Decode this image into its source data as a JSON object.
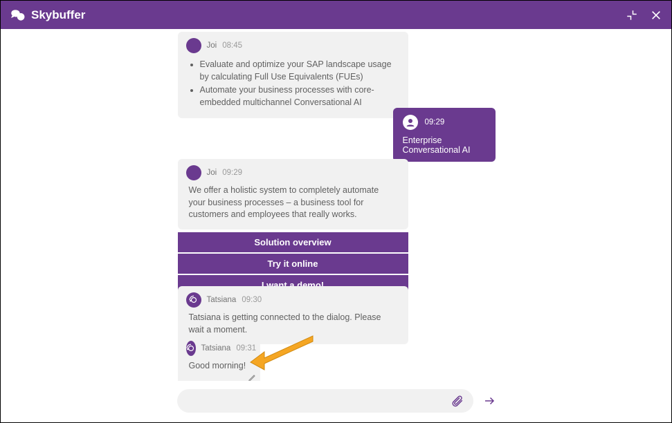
{
  "header": {
    "title": "Skybuffer"
  },
  "messages": {
    "m0": {
      "sender": "Joi",
      "time": "08:45",
      "bullets": [
        "Evaluate and optimize your SAP landscape usage by calculating Full Use Equivalents (FUEs)",
        "Automate your business processes with core-embedded multichannel Conversational AI"
      ]
    },
    "m1": {
      "time": "09:29",
      "text": "Enterprise Conversational AI"
    },
    "m2": {
      "sender": "Joi",
      "time": "09:29",
      "text": "We offer a holistic system to completely automate your business processes – a business tool for customers and employees that really works."
    },
    "m3": {
      "sender": "Tatsiana",
      "time": "09:30",
      "text": "Tatsiana is getting connected to the dialog. Please wait a moment."
    },
    "m4": {
      "sender": "Tatsiana",
      "time": "09:31",
      "text": "Good morning!"
    }
  },
  "buttons": {
    "b0": "Solution overview",
    "b1": "Try it online",
    "b2": "I want a demo!"
  },
  "composer": {
    "placeholder": ""
  }
}
